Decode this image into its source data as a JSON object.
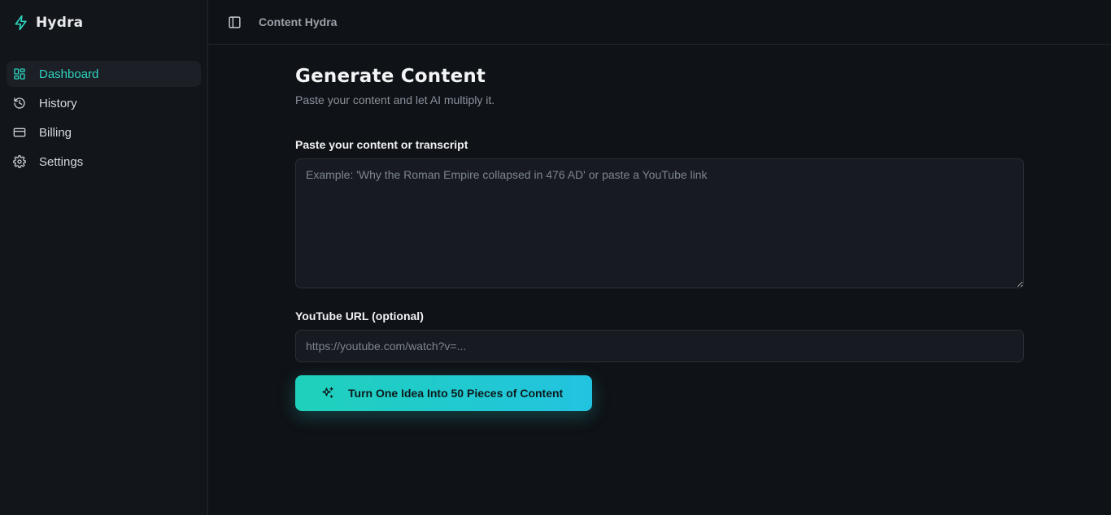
{
  "app": {
    "name": "Hydra"
  },
  "sidebar": {
    "items": [
      {
        "label": "Dashboard",
        "icon": "dashboard-icon",
        "active": true
      },
      {
        "label": "History",
        "icon": "history-icon",
        "active": false
      },
      {
        "label": "Billing",
        "icon": "credit-card-icon",
        "active": false
      },
      {
        "label": "Settings",
        "icon": "gear-icon",
        "active": false
      }
    ]
  },
  "header": {
    "breadcrumb": "Content Hydra"
  },
  "main": {
    "title": "Generate Content",
    "subtitle": "Paste your content and let AI multiply it.",
    "content_label": "Paste your content or transcript",
    "content_placeholder": "Example: 'Why the Roman Empire collapsed in 476 AD' or paste a YouTube link",
    "content_value": "",
    "url_label": "YouTube URL (optional)",
    "url_placeholder": "https://youtube.com/watch?v=...",
    "url_value": "",
    "cta_label": "Turn One Idea Into 50 Pieces of Content"
  },
  "colors": {
    "accent": "#2dd4bf",
    "cta_gradient_start": "#1fd1bb",
    "cta_gradient_end": "#22c3e0",
    "background": "#0f1216",
    "sidebar_background": "#121519"
  }
}
